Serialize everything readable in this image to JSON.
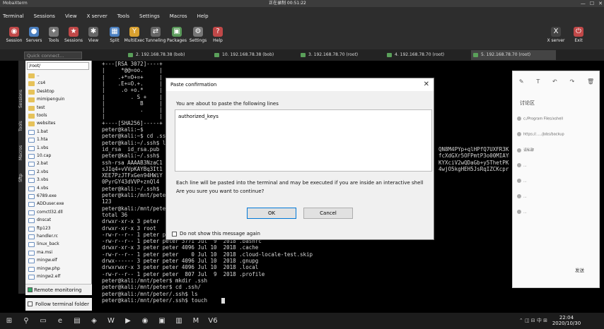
{
  "titlebar": {
    "app": "MobaXterm",
    "recording": "正在录制 00:51:22"
  },
  "menubar": [
    "Terminal",
    "Sessions",
    "View",
    "X server",
    "Tools",
    "Settings",
    "Macros",
    "Help"
  ],
  "toolbar": [
    {
      "label": "Session",
      "icon": "session-icon",
      "color": "#c04848"
    },
    {
      "label": "Servers",
      "icon": "servers-icon",
      "color": "#4a7fbf"
    },
    {
      "label": "Tools",
      "icon": "tools-icon",
      "color": "#777777"
    },
    {
      "label": "Sessions",
      "icon": "sessions-icon",
      "color": "#c04848"
    },
    {
      "label": "View",
      "icon": "view-icon",
      "color": "#666666"
    },
    {
      "label": "Split",
      "icon": "split-icon",
      "color": "#4a7fbf"
    },
    {
      "label": "MultiExec",
      "icon": "multiexec-icon",
      "color": "#d8a030"
    },
    {
      "label": "Tunneling",
      "icon": "tunneling-icon",
      "color": "#666666"
    },
    {
      "label": "Packages",
      "icon": "packages-icon",
      "color": "#5a9a5a"
    },
    {
      "label": "Settings",
      "icon": "settings-icon",
      "color": "#777777"
    },
    {
      "label": "Help",
      "icon": "help-icon",
      "color": "#c04848"
    },
    {
      "label": "X server",
      "icon": "xserver-icon",
      "color": "#444444"
    },
    {
      "label": "Exit",
      "icon": "exit-icon",
      "color": "#c04848"
    }
  ],
  "quick_connect_placeholder": "Quick connect...",
  "tabs": [
    "2. 192.168.78.38 (bob)",
    "10. 192.168.78.38 (bob)",
    "3. 192.168.78.70 (root)",
    "4. 192.168.78.70 (root)",
    "5. 192.168.78.70 (root)"
  ],
  "side_tabs": [
    "Sessions",
    "Tools",
    "Macros",
    "Sftp"
  ],
  "file_panel": {
    "path": "/root/",
    "files": [
      {
        "name": "..",
        "type": "folder"
      },
      {
        "name": ".cs4",
        "type": "folder"
      },
      {
        "name": "Desktop",
        "type": "folder"
      },
      {
        "name": "mimipenguin",
        "type": "folder"
      },
      {
        "name": "test",
        "type": "folder"
      },
      {
        "name": "tools",
        "type": "folder"
      },
      {
        "name": "websites",
        "type": "folder"
      },
      {
        "name": "1.bat",
        "type": "file"
      },
      {
        "name": "1.hta",
        "type": "file"
      },
      {
        "name": "1.vbs",
        "type": "file"
      },
      {
        "name": "10.cap",
        "type": "file"
      },
      {
        "name": "2.bat",
        "type": "file"
      },
      {
        "name": "2.vbs",
        "type": "file"
      },
      {
        "name": "3.vbs",
        "type": "file"
      },
      {
        "name": "4.vbs",
        "type": "file"
      },
      {
        "name": "6789.exe",
        "type": "file"
      },
      {
        "name": "ADDuser.exe",
        "type": "file"
      },
      {
        "name": "comctl32.dll",
        "type": "file"
      },
      {
        "name": "dnscat",
        "type": "file"
      },
      {
        "name": "ftp123",
        "type": "file"
      },
      {
        "name": "handler.rc",
        "type": "file"
      },
      {
        "name": "linux_back",
        "type": "file"
      },
      {
        "name": "ma.msi",
        "type": "file"
      },
      {
        "name": "mingw.elf",
        "type": "file"
      },
      {
        "name": "mingw.php",
        "type": "file"
      },
      {
        "name": "mingw2.elf",
        "type": "file"
      }
    ],
    "remote_monitoring": "Remote monitoring",
    "follow_folder": "Follow terminal folder"
  },
  "terminal": {
    "lines_left": [
      "+---[RSA 3072]----+",
      "|     *@@=oo.     |",
      "|    .+*=O+=+     |",
      "|    .E+=O.+.     |",
      "|     .o +o.*     |",
      "|        . S +    |",
      "|           B     |",
      "|           .     |",
      "|                 |",
      "+----[SHA256]-----+",
      "peter@kali:~$",
      "peter@kali:~$ cd .ssh",
      "peter@kali:~/.ssh$ ls",
      "id_rsa  id_rsa.pub",
      "peter@kali:~/.ssh$",
      "ssh-rsa AAAAB3NzaC1",
      "sJIq4+vVVpKAYBq3It1",
      "XEE7PzJTFxGen94HWiY",
      "0PyrGY43dVVP+znQl4",
      "peter@kali:~/.ssh$",
      "peter@kali:/mnt/peter",
      "123",
      "peter@kali:/mnt/peter",
      "total 36",
      "drwxr-xr-x 3 peter",
      "drwxr-xr-x 3 root",
      "-rw-r--r-- 1 peter peter  220 Jul  9  2018 .bash_logout",
      "-rw-r--r-- 1 peter peter 3771 Jul  9  2018 .bashrc",
      "drwxr-xr-x 3 peter peter 4096 Jul 10  2018 .cache",
      "-rw-r--r-- 1 peter peter    0 Jul 10  2018 .cloud-locale-test.skip",
      "drwx------ 3 peter peter 4096 Jul 10  2018 .gnupg",
      "drwxrwxr-x 3 peter peter 4096 Jul 10  2018 .local",
      "-rw-r--r-- 1 peter peter  807 Jul  9  2018 .profile",
      "peter@kali:/mnt/peter$ mkdir .ssh",
      "peter@kali:/mnt/peter$ cd .ssh/",
      "peter@kali:/mnt/peter/.ssh$ ls",
      "peter@kali:/mnt/peter/.ssh$ touch "
    ],
    "lines_right": [
      "QN8M4PYp+qlHPfQ7UXFR3Kk",
      "fcXdGXr5OFPmtP3o00MIAYD",
      "KYXciV2wQDaGb+y5ThetPK/",
      "4wjO5kgHEH5JsRqIZCKcprs"
    ]
  },
  "modal": {
    "title": "Paste confirmation",
    "close": "✕",
    "message": "You are about to paste the following lines",
    "content": "authorized_keys",
    "warning1": "Each line will be pasted into the terminal and may be executed if you are inside an interactive shell",
    "warning2": "Are you sure you want to continue?",
    "ok": "OK",
    "cancel": "Cancel",
    "dont_show": "Do not show this message again"
  },
  "chat": {
    "tab": "讨论区",
    "send": "发送",
    "messages": [
      "c:/Program Files/xshell",
      "https://...../Jobs/backup",
      "请私聊",
      "...",
      "...",
      "...",
      "..."
    ]
  },
  "taskbar": {
    "time": "22:04",
    "date": "2020/10/30",
    "apps": [
      "windows-start-icon",
      "search-icon",
      "task-view-icon",
      "edge-icon",
      "explorer-icon",
      "store-icon",
      "word-icon",
      "terminal-icon",
      "chrome-icon",
      "vmware-icon",
      "file-icon",
      "mobaxterm-icon",
      "v6-icon"
    ]
  }
}
